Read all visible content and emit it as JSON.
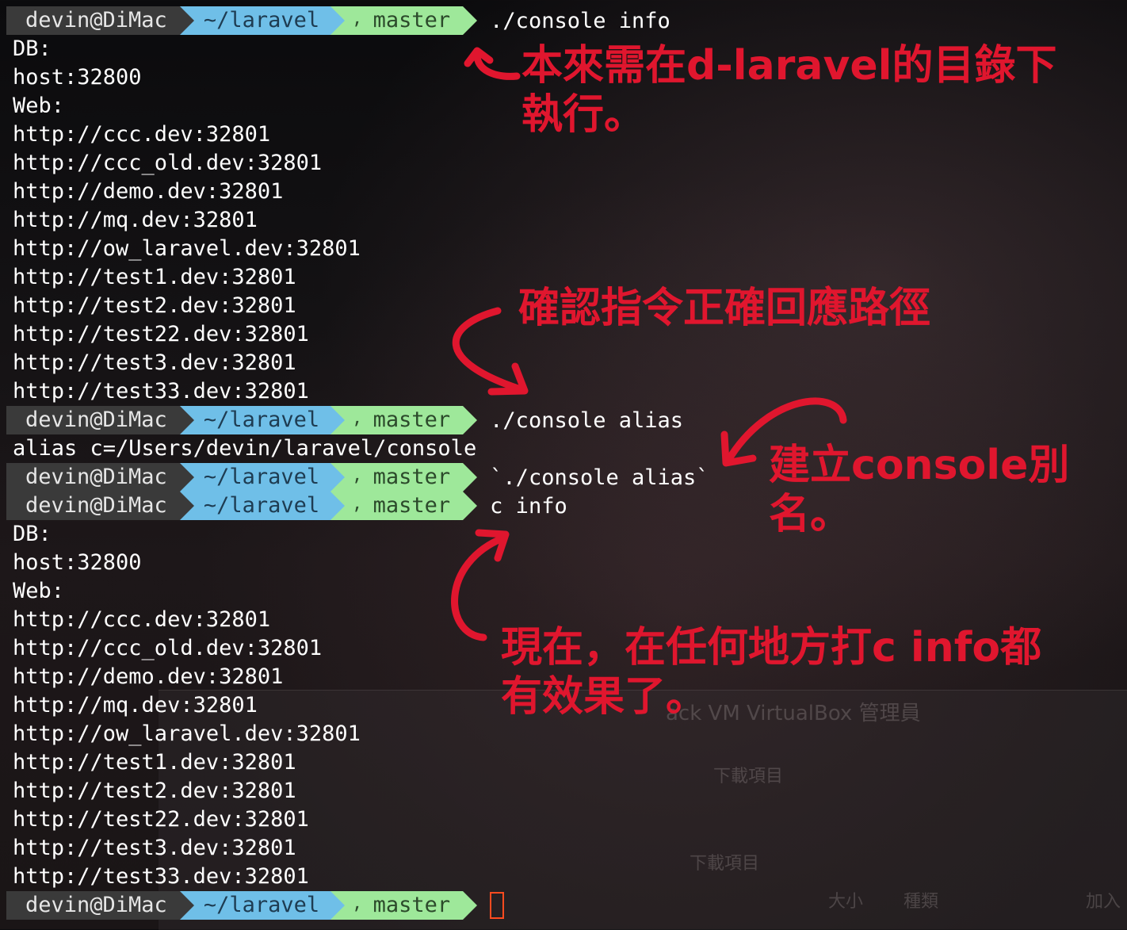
{
  "colors": {
    "annotation": "#e0162e",
    "segment_user": "#3a3a3a",
    "segment_dir": "#6fbfe8",
    "segment_git": "#9ee89a",
    "cursor": "#ff4b1f"
  },
  "prompt": {
    "user": "devin@DiMac",
    "dir": "~/laravel",
    "branch": "master",
    "branch_icon": "git-branch-icon"
  },
  "commands": {
    "cmd1": "./console info",
    "cmd2": "./console alias",
    "cmd3": "`./console alias`",
    "cmd4": "c info"
  },
  "output1": [
    "DB:",
    "host:32800",
    "Web:",
    "http://ccc.dev:32801",
    "http://ccc_old.dev:32801",
    "http://demo.dev:32801",
    "http://mq.dev:32801",
    "http://ow_laravel.dev:32801",
    "http://test1.dev:32801",
    "http://test2.dev:32801",
    "http://test22.dev:32801",
    "http://test3.dev:32801",
    "http://test33.dev:32801"
  ],
  "alias_output": "alias c=/Users/devin/laravel/console",
  "output2": [
    "DB:",
    "host:32800",
    "Web:",
    "http://ccc.dev:32801",
    "http://ccc_old.dev:32801",
    "http://demo.dev:32801",
    "http://mq.dev:32801",
    "http://ow_laravel.dev:32801",
    "http://test1.dev:32801",
    "http://test2.dev:32801",
    "http://test22.dev:32801",
    "http://test3.dev:32801",
    "http://test33.dev:32801"
  ],
  "annotations": {
    "note1": "本來需在d-laravel的目錄下\n執行。",
    "note2": "確認指令正確回應路徑",
    "note3": "建立console別\n名。",
    "note4": "現在，在任何地方打c info都\n有效果了。"
  },
  "background_window": {
    "title": "ack VM VirtualBox 管理員",
    "downloads_heading": "下載項目",
    "downloads_label": "下載項目",
    "col_size": "大小",
    "col_kind": "種類",
    "col_added": "加入"
  }
}
